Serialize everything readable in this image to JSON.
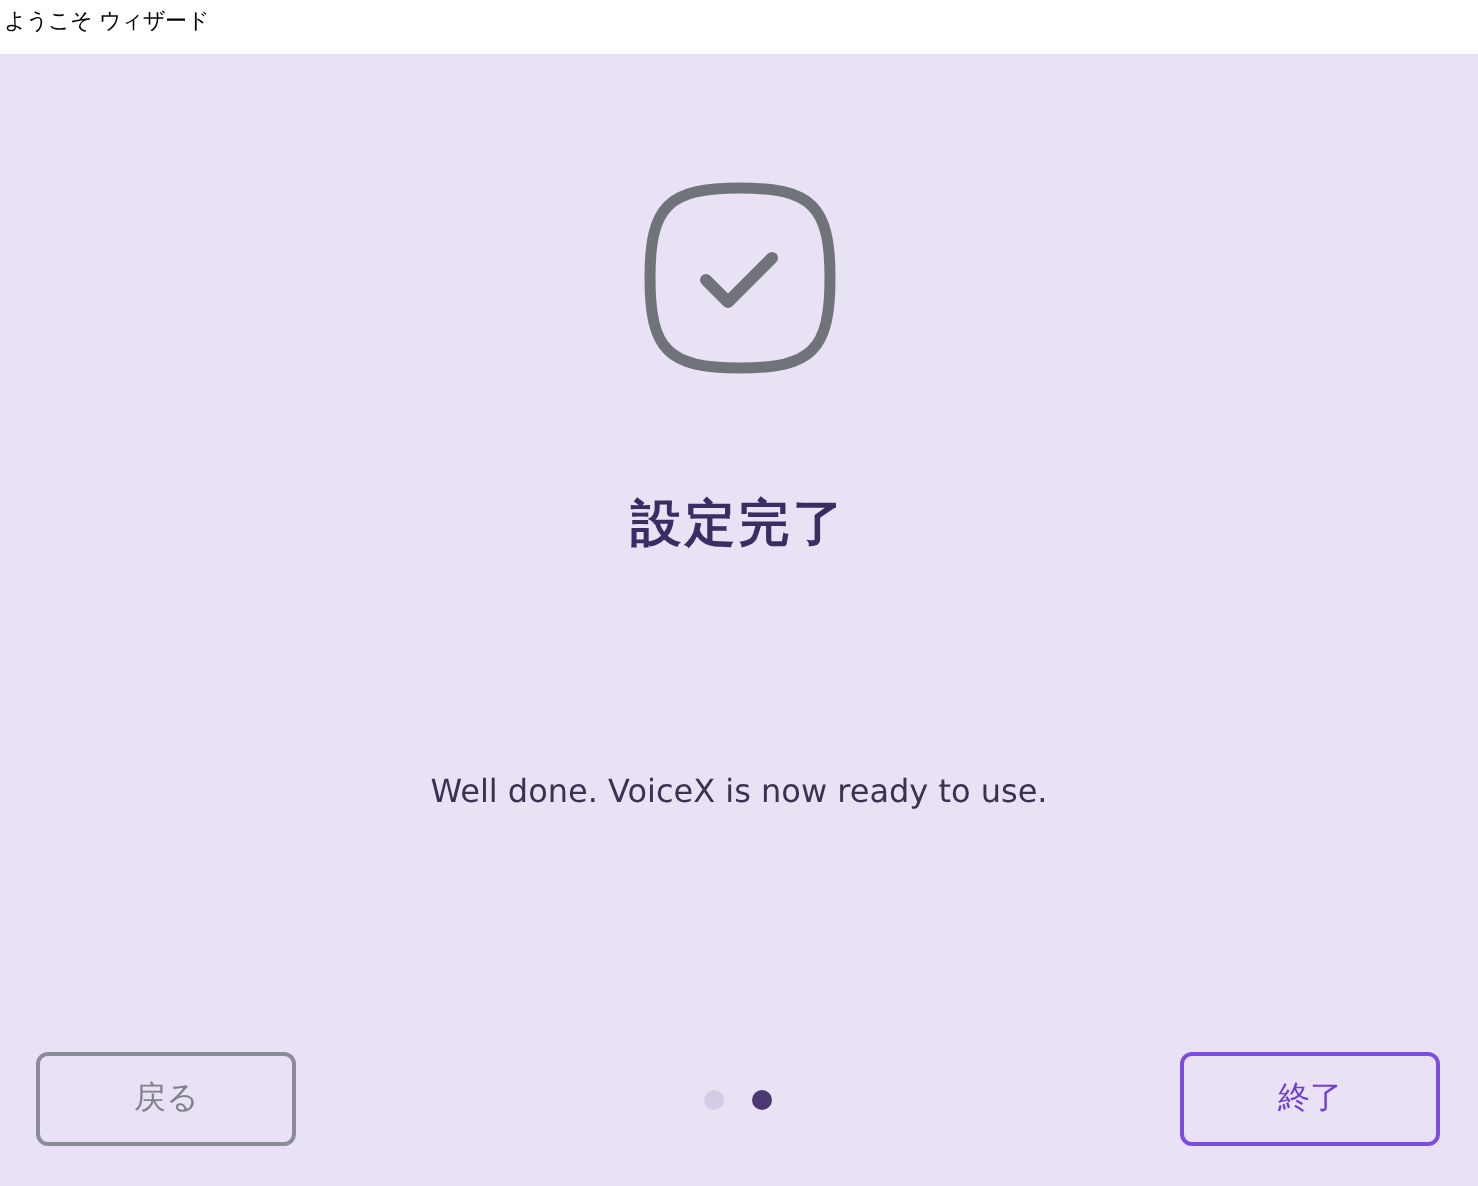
{
  "window": {
    "title": "ようこそ ウィザード"
  },
  "heading": "設定完了",
  "message": "Well done. VoiceX is now ready to use.",
  "back_button": {
    "label": "戻る",
    "disabled": true
  },
  "pages": [
    {
      "selected": false
    },
    {
      "selected": true
    }
  ],
  "finish_button": {
    "label": "終了",
    "disabled": false
  }
}
